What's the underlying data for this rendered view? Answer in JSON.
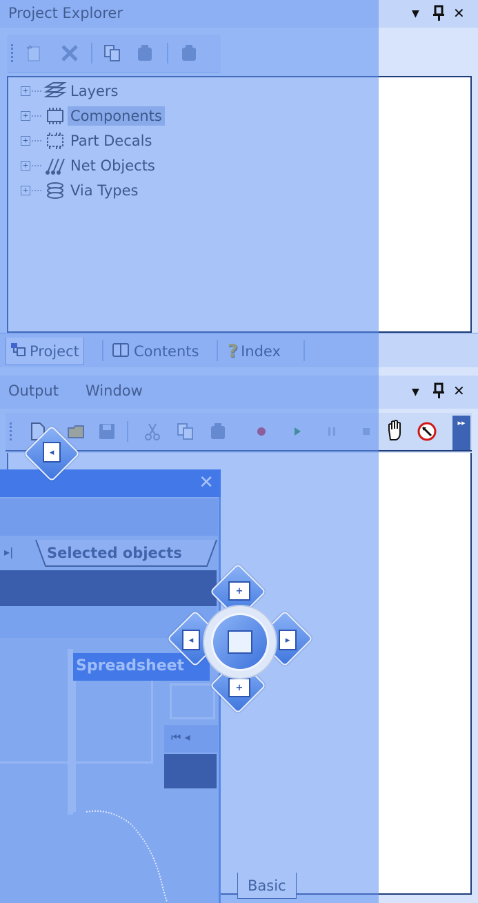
{
  "project_explorer": {
    "title": "Project Explorer",
    "pin_icon": "pin-icon",
    "close_label": "✕",
    "toolbar_icons": [
      "new-item-icon",
      "delete-icon",
      "copy-icon",
      "paste-icon",
      "paste-special-icon"
    ],
    "tree": [
      {
        "label": "Layers",
        "icon": "layers-icon",
        "expander": "+",
        "selected": false
      },
      {
        "label": "Components",
        "icon": "components-icon",
        "expander": "+",
        "selected": true
      },
      {
        "label": "Part Decals",
        "icon": "part-decals-icon",
        "expander": "+",
        "selected": false
      },
      {
        "label": "Net Objects",
        "icon": "net-objects-icon",
        "expander": "+",
        "selected": false
      },
      {
        "label": "Via Types",
        "icon": "via-types-icon",
        "expander": "+",
        "selected": false
      }
    ],
    "tabs": [
      {
        "label": "Project",
        "icon": "project-icon",
        "active": true
      },
      {
        "label": "Contents",
        "icon": "book-icon",
        "active": false
      },
      {
        "label": "Index",
        "icon": "question-icon",
        "active": false
      }
    ]
  },
  "output_window": {
    "title_part1": "Output",
    "title_part2": "Window",
    "close_label": "✕",
    "toolbar_icons": [
      "new-file-icon",
      "open-folder-icon",
      "save-icon",
      "cut-icon",
      "copy-icon",
      "paste-icon",
      "record-icon",
      "play-icon",
      "pause-icon",
      "stop-icon",
      "hand-icon",
      "no-select-icon"
    ],
    "bottom_tab": "Basic"
  },
  "floating_panel": {
    "close_label": "✕",
    "nav_label": "▸|",
    "selected_tab": "Selected objects",
    "spreadsheet_title": "Spreadsheet",
    "nav_first_prev": "⏮ ◂"
  },
  "colors": {
    "title_blue": "#1e59dc",
    "drag_tint": "#6092f0",
    "dark_band": "#0c2158"
  }
}
